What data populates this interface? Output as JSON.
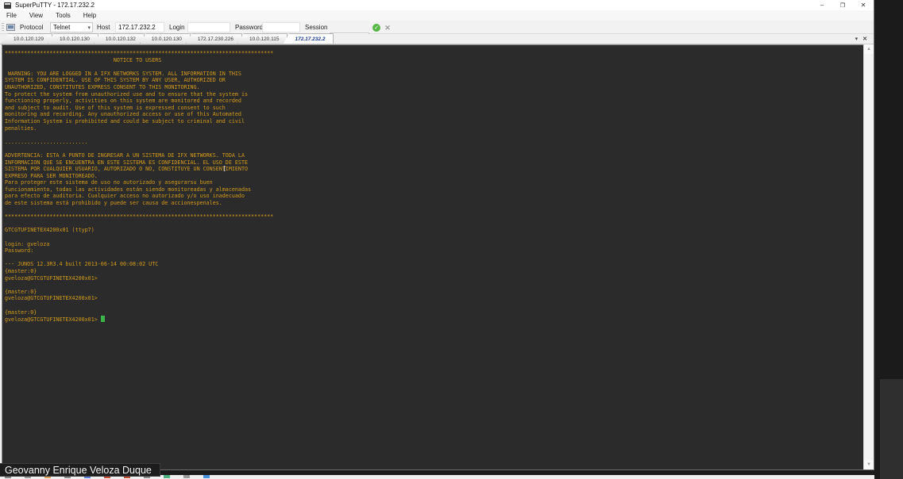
{
  "window": {
    "title": "SuperPuTTY - 172.17.232.2",
    "menu": [
      "File",
      "View",
      "Tools",
      "Help"
    ]
  },
  "toolbar": {
    "protocol_label": "Protocol",
    "protocol_value": "Telnet",
    "host_label": "Host",
    "host_value": "172.17.232.2",
    "login_label": "Login",
    "login_value": "",
    "password_label": "Password",
    "password_value": "",
    "session_label": "Session",
    "session_value": ""
  },
  "tabs": [
    {
      "label": "10.0.120.129",
      "active": false
    },
    {
      "label": "10.0.120.130",
      "active": false
    },
    {
      "label": "10.0.120.132",
      "active": false
    },
    {
      "label": "10.0.120.130",
      "active": false
    },
    {
      "label": "172.17.230.226",
      "active": false
    },
    {
      "label": "10.0.120.115",
      "active": false
    },
    {
      "label": "172.17.232.2",
      "active": true
    }
  ],
  "terminal": {
    "colors": {
      "background": "#2b2b2b",
      "text": "#d29b1d",
      "cursor": "#3bb54a"
    },
    "lines": [
      "************************************************************************************",
      "                                  NOTICE TO USERS",
      "",
      " WARNING: YOU ARE LOGGED IN A IFX NETWORKS SYSTEM. ALL INFORMATION IN THIS",
      "SYSTEM IS CONFIDENTIAL. USE OF THIS SYSTEM BY ANY USER, AUTHORIZED OR",
      "UNAUTHORIZED, CONSTITUTES EXPRESS CONSENT TO THIS MONITORING.",
      "To protect the system from unauthorized use and to ensure that the system is",
      "functioning properly, activities on this system are monitored and recorded",
      "and subject to audit. Use of this system is expressed consent to such",
      "monitoring and recording. Any unauthorized access or use of this Automated",
      "Information System is prohibited and could be subject to criminal and civil",
      "penalties.",
      "",
      "..........................",
      "",
      "ADVERTENCIA: ESTA A PUNTO DE INGRESAR A UN SISTEMA DE IFX NETWORKS. TODA LA",
      "INFORMACION QUE SE ENCUENTRA EN ESTE SISTEMA ES CONFIDENCIAL. EL USO DE ESTE",
      "SISTEMA POR CUALQUIER USUARIO, AUTORIZADO O NO, CONSTITUYE UN CONSENTIMIENTO",
      "EXPRESO PARA SER MONITOREADO.",
      "Para proteger este sistema de uso no autorizado y asegurarsu buen",
      "funcionamiento, todas las actividades están siendo monitoreadas y almacenadas",
      "para efecto de auditoria. Cualquier acceso no autorizado y/o uso inadecuado",
      "de este sistema está prohibido y puede ser causa de accionespenales.",
      "",
      "************************************************************************************",
      "",
      "GTCGTUFINETEX4200x01 (ttyp7)",
      "",
      "login: gveloza",
      "Password:",
      "",
      "--- JUNOS 12.3R3.4 built 2013-06-14 00:08:02 UTC",
      "{master:0}",
      "gveloza@GTCGTUFINETEX4200x01>",
      "",
      "{master:0}",
      "gveloza@GTCGTUFINETEX4200x01>",
      "",
      "{master:0}",
      "gveloza@GTCGTUFINETEX4200x01> "
    ]
  },
  "tooltip": {
    "text": "Geovanny Enrique Veloza Duque"
  },
  "taskbar": {
    "icon_colors": [
      "#8a8a8a",
      "#9a9a9a",
      "#d9a05a",
      "#8a8a8a",
      "#5a7fd9",
      "#c94c3a",
      "#c94c3a",
      "#8a8a8a",
      "#4caf7d",
      "#9a9a9a",
      "#4a8fd9"
    ]
  }
}
